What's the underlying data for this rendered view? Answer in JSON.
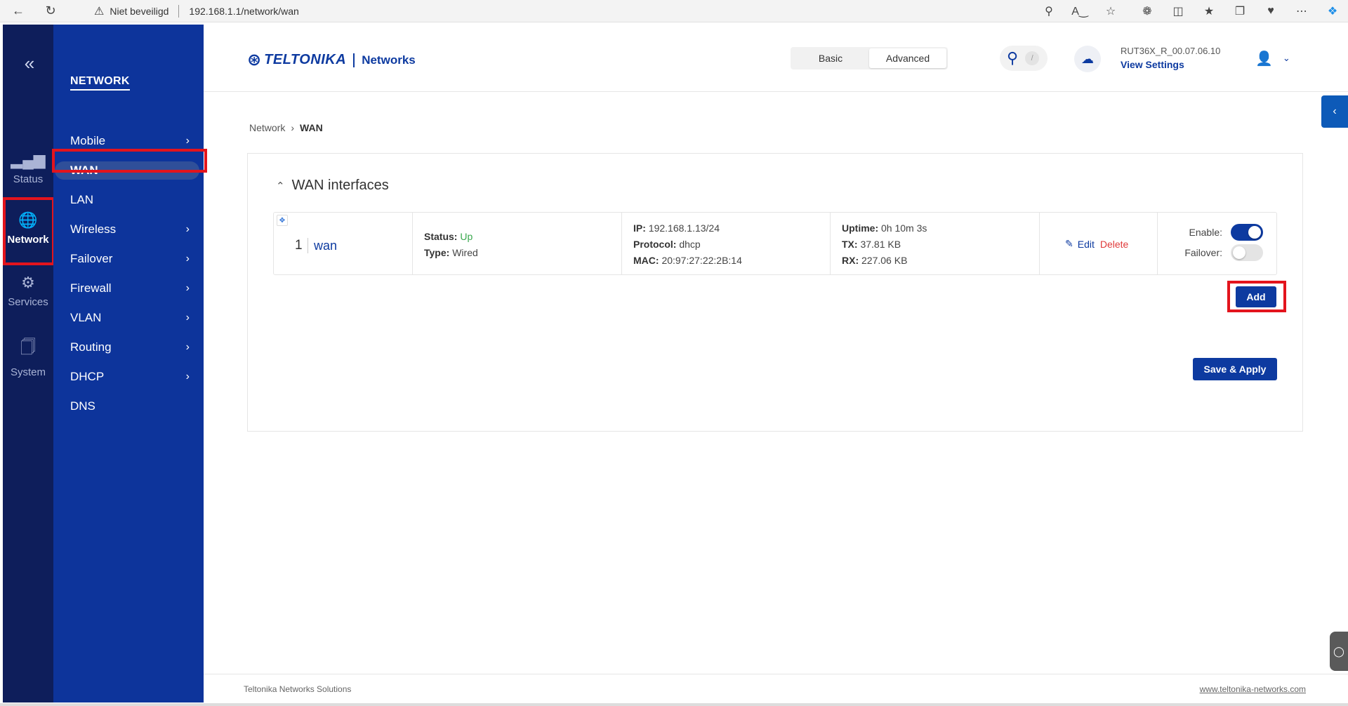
{
  "browser": {
    "security_label": "Niet beveiligd",
    "url": "192.168.1.1/network/wan",
    "icons": [
      "back-icon",
      "refresh-icon",
      "warning-icon",
      "key-icon",
      "read-aloud-icon",
      "favorite-icon",
      "extensions-icon",
      "split-screen-icon",
      "favorites-icon",
      "collections-icon",
      "performance-icon",
      "more-icon",
      "copilot-icon"
    ]
  },
  "iconbar": {
    "collapse": "«",
    "items": [
      {
        "label": "Status",
        "icon": "signal-icon"
      },
      {
        "label": "Network",
        "icon": "globe-icon"
      },
      {
        "label": "Services",
        "icon": "gear-icon"
      },
      {
        "label": "System",
        "icon": "system-icon"
      }
    ]
  },
  "nav": {
    "title": "NETWORK",
    "items": [
      {
        "label": "Mobile",
        "chevron": true
      },
      {
        "label": "WAN",
        "chevron": false,
        "active": true
      },
      {
        "label": "LAN",
        "chevron": false
      },
      {
        "label": "Wireless",
        "chevron": true
      },
      {
        "label": "Failover",
        "chevron": true
      },
      {
        "label": "Firewall",
        "chevron": true
      },
      {
        "label": "VLAN",
        "chevron": true
      },
      {
        "label": "Routing",
        "chevron": true
      },
      {
        "label": "DHCP",
        "chevron": true
      },
      {
        "label": "DNS",
        "chevron": false
      }
    ]
  },
  "header": {
    "brand": "TELTONIKA",
    "brand_sub": "Networks",
    "mode_basic": "Basic",
    "mode_advanced": "Advanced",
    "search_shortcut": "/",
    "firmware": "RUT36X_R_00.07.06.10",
    "view_settings": "View Settings"
  },
  "breadcrumb": {
    "parent": "Network",
    "current": "WAN"
  },
  "card": {
    "title": "WAN interfaces",
    "interface": {
      "index": "1",
      "name": "wan",
      "status_label": "Status:",
      "status_value": "Up",
      "type_label": "Type:",
      "type_value": "Wired",
      "ip_label": "IP:",
      "ip_value": "192.168.1.13/24",
      "protocol_label": "Protocol:",
      "protocol_value": "dhcp",
      "mac_label": "MAC:",
      "mac_value": "20:97:27:22:2B:14",
      "uptime_label": "Uptime:",
      "uptime_value": "0h 10m 3s",
      "tx_label": "TX:",
      "tx_value": "37.81 KB",
      "rx_label": "RX:",
      "rx_value": "227.06 KB",
      "edit_label": "Edit",
      "delete_label": "Delete",
      "enable_label": "Enable:",
      "enable_on": true,
      "failover_label": "Failover:",
      "failover_on": false
    },
    "add_label": "Add",
    "save_label": "Save & Apply"
  },
  "footer": {
    "left": "Teltonika Networks Solutions",
    "right": "www.teltonika-networks.com"
  },
  "colors": {
    "iconbar_bg": "#0e1e5b",
    "nav_bg": "#0d349b",
    "accent": "#0d3aa0",
    "status_up": "#3aa84e",
    "delete": "#e03a3a",
    "highlight_box": "#e3141d"
  }
}
